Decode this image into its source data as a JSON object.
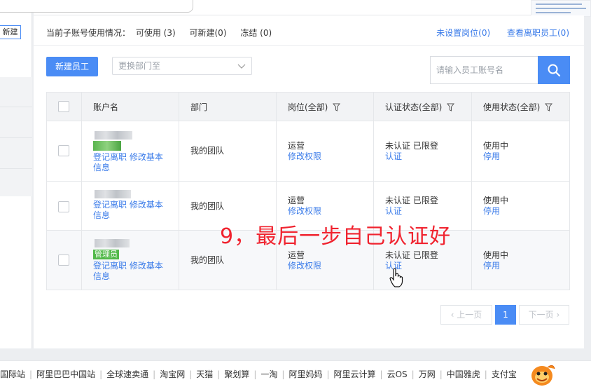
{
  "left_panel": {
    "new_button": "新建"
  },
  "usage": {
    "label": "当前子账号使用情况：",
    "available": "可使用 (3)",
    "creatable": "可新建(0)",
    "frozen": "冻结 (0)"
  },
  "top_links": {
    "unassigned": "未设置岗位(0)",
    "departed": "查看离职员工(0)"
  },
  "toolbar": {
    "new_employee": "新建员工",
    "dept_placeholder": "更换部门至",
    "search_placeholder": "请输入员工账号名"
  },
  "table": {
    "headers": {
      "account": "账户名",
      "dept": "部门",
      "position": "岗位(全部)",
      "auth": "认证状态(全部)",
      "usage": "使用状态(全部)"
    },
    "rows": [
      {
        "tag": "",
        "ops1": "登记离职",
        "ops2": "修改基本",
        "ops3": "信息",
        "dept": "我的团队",
        "position": "运营",
        "position_link": "修改权限",
        "auth": "未认证 已限登",
        "auth_link": "认证",
        "usage": "使用中",
        "usage_link": "停用"
      },
      {
        "tag": "",
        "ops1": "登记离职",
        "ops2": "修改基本",
        "ops3": "信息",
        "dept": "我的团队",
        "position": "运营",
        "position_link": "修改权限",
        "auth": "未认证 已限登",
        "auth_link": "认证",
        "usage": "使用中",
        "usage_link": "停用"
      },
      {
        "tag": "管理员",
        "ops1": "登记离职",
        "ops2": "修改基本",
        "ops3": "信息",
        "dept": "我的团队",
        "position": "运营",
        "position_link": "修改权限",
        "auth": "未认证 已限登",
        "auth_link": "认证",
        "usage": "使用中",
        "usage_link": "停用"
      }
    ]
  },
  "overlay": "9，最后一步自己认证好",
  "pager": {
    "prev": "上一页",
    "page": "1",
    "next": "下一页"
  },
  "footer": [
    "国际站",
    "阿里巴巴中国站",
    "全球速卖通",
    "淘宝网",
    "天猫",
    "聚划算",
    "一淘",
    "阿里妈妈",
    "阿里云计算",
    "云OS",
    "万网",
    "中国雅虎",
    "支付宝"
  ],
  "colors": {
    "primary": "#4a8cf5",
    "link": "#3a7be9",
    "overlay_red": "#f0232f",
    "admin_green": "#52b94a"
  }
}
